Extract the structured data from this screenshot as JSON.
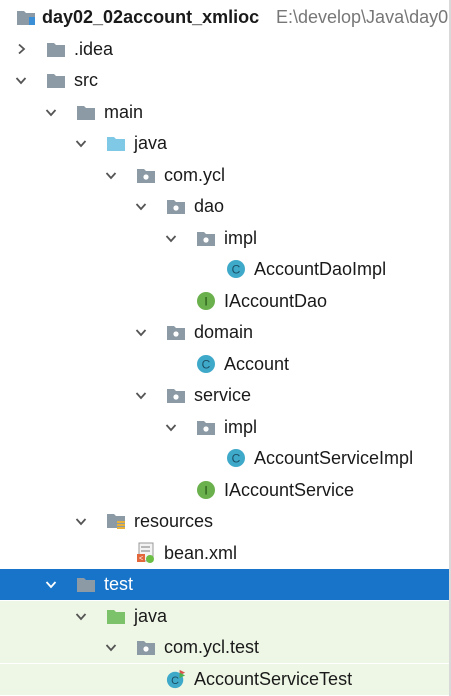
{
  "project": {
    "name": "day02_02account_xmlioc",
    "path": "E:\\develop\\Java\\day0"
  },
  "tree": [
    {
      "label": "day02_02account_xmlioc",
      "depth": 0,
      "arrow": "none",
      "icon": "module-icon",
      "bold": true,
      "hint": "E:\\develop\\Java\\day0"
    },
    {
      "label": ".idea",
      "depth": 0,
      "arrow": "collapsed",
      "icon": "folder-icon"
    },
    {
      "label": "src",
      "depth": 0,
      "arrow": "expanded",
      "icon": "folder-icon"
    },
    {
      "label": "main",
      "depth": 1,
      "arrow": "expanded",
      "icon": "folder-icon"
    },
    {
      "label": "java",
      "depth": 2,
      "arrow": "expanded",
      "icon": "source-folder-icon"
    },
    {
      "label": "com.ycl",
      "depth": 3,
      "arrow": "expanded",
      "icon": "package-icon"
    },
    {
      "label": "dao",
      "depth": 4,
      "arrow": "expanded",
      "icon": "package-icon"
    },
    {
      "label": "impl",
      "depth": 5,
      "arrow": "expanded",
      "icon": "package-icon"
    },
    {
      "label": "AccountDaoImpl",
      "depth": 6,
      "arrow": "none",
      "icon": "class-icon"
    },
    {
      "label": "IAccountDao",
      "depth": 5,
      "arrow": "none",
      "icon": "interface-icon"
    },
    {
      "label": "domain",
      "depth": 4,
      "arrow": "expanded",
      "icon": "package-icon"
    },
    {
      "label": "Account",
      "depth": 5,
      "arrow": "none",
      "icon": "class-icon"
    },
    {
      "label": "service",
      "depth": 4,
      "arrow": "expanded",
      "icon": "package-icon"
    },
    {
      "label": "impl",
      "depth": 5,
      "arrow": "expanded",
      "icon": "package-icon"
    },
    {
      "label": "AccountServiceImpl",
      "depth": 6,
      "arrow": "none",
      "icon": "class-icon"
    },
    {
      "label": "IAccountService",
      "depth": 5,
      "arrow": "none",
      "icon": "interface-icon"
    },
    {
      "label": "resources",
      "depth": 2,
      "arrow": "expanded",
      "icon": "resources-folder-icon"
    },
    {
      "label": "bean.xml",
      "depth": 3,
      "arrow": "none",
      "icon": "xml-file-icon"
    },
    {
      "label": "test",
      "depth": 1,
      "arrow": "expanded",
      "icon": "folder-icon",
      "selected": true
    },
    {
      "label": "java",
      "depth": 2,
      "arrow": "expanded",
      "icon": "test-source-folder-icon",
      "test": true
    },
    {
      "label": "com.ycl.test",
      "depth": 3,
      "arrow": "expanded",
      "icon": "package-icon",
      "test": true
    },
    {
      "label": "AccountServiceTest",
      "depth": 4,
      "arrow": "none",
      "icon": "test-class-icon",
      "test": true
    }
  ],
  "colors": {
    "selection": "#1874c8",
    "test_background": "#eef7e6",
    "folder": "#8c9aa5",
    "source_folder": "#7fc8e6",
    "test_folder": "#7cc26a",
    "class": "#3fa9c9",
    "interface": "#6ab04c"
  }
}
